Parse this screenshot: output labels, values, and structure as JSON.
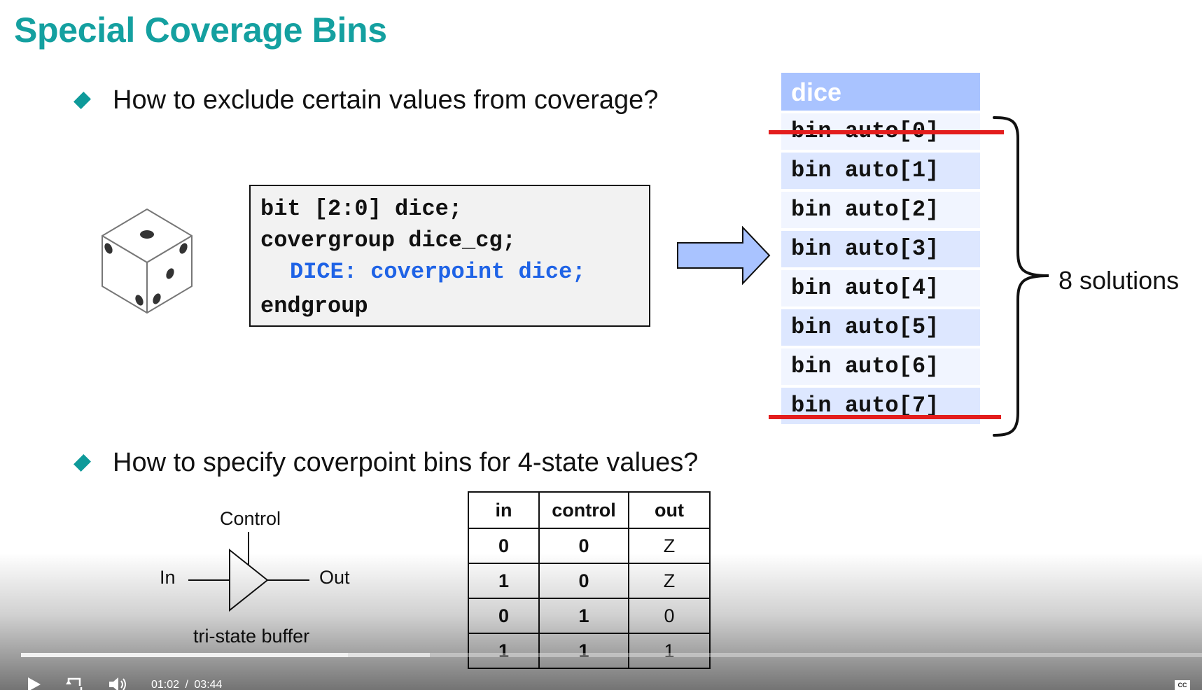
{
  "slide": {
    "title": "Special Coverage Bins",
    "bullets": [
      "How to exclude certain values from coverage?",
      "How to specify coverpoint bins for 4-state values?"
    ],
    "code": {
      "line1": "bit [2:0] dice;",
      "line2": "covergroup dice_cg;",
      "line3": "DICE: coverpoint dice;",
      "line4": "endgroup"
    },
    "bins": {
      "header": "dice",
      "rows": [
        "bin auto[0]",
        "bin auto[1]",
        "bin auto[2]",
        "bin auto[3]",
        "bin auto[4]",
        "bin auto[5]",
        "bin auto[6]",
        "bin auto[7]"
      ],
      "struck_rows": [
        0,
        7
      ],
      "summary": "8 solutions"
    },
    "buffer": {
      "control_label": "Control",
      "in_label": "In",
      "out_label": "Out",
      "caption": "tri-state buffer"
    },
    "truth_table": {
      "headers": [
        "in",
        "control",
        "out"
      ],
      "rows": [
        [
          "0",
          "0",
          "Z"
        ],
        [
          "1",
          "0",
          "Z"
        ],
        [
          "0",
          "1",
          "0"
        ],
        [
          "1",
          "1",
          "1"
        ]
      ]
    },
    "colors": {
      "title": "#14a0a0",
      "bullet": "#0e9a9a",
      "code_highlight": "#1f63e6",
      "bin_header": "#a9c3ff",
      "strike": "#e31d1d"
    }
  },
  "player": {
    "current_time": "01:02",
    "separator": "/",
    "duration": "03:44",
    "progress_fraction": 0.277,
    "buffered_fraction": 0.346,
    "icons": [
      "play-icon",
      "replay-icon",
      "volume-icon",
      "captions-icon"
    ]
  }
}
